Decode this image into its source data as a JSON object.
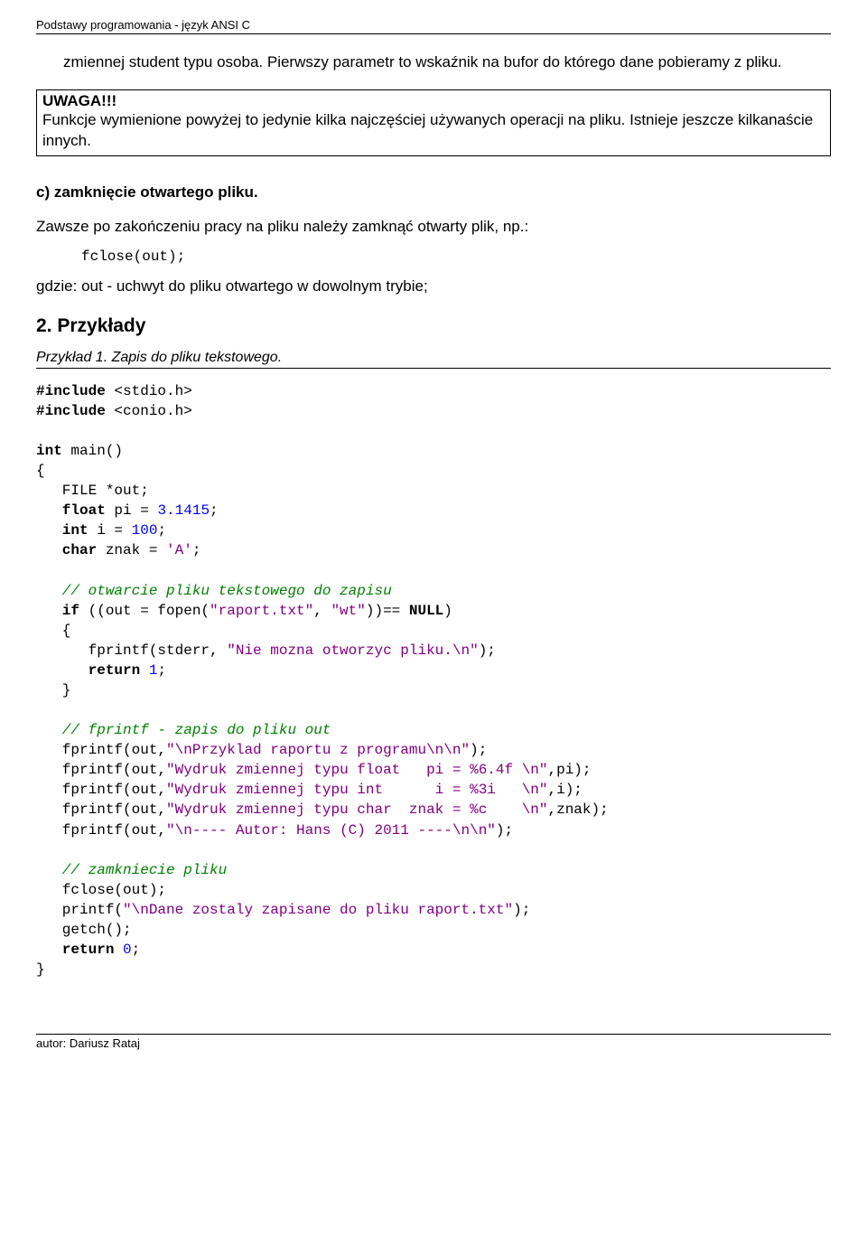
{
  "header": "Podstawy programowania - język ANSI C",
  "para_intro": "zmiennej student typu osoba. Pierwszy parametr to wskaźnik na bufor do którego dane pobieramy z pliku.",
  "uwaga": {
    "title": "UWAGA!!!",
    "text": "Funkcje wymienione powyżej to jedynie kilka najczęściej używanych operacji na pliku. Istnieje jeszcze kilkanaście innych."
  },
  "section_c": "c) zamknięcie otwartego pliku.",
  "section_c_text": "Zawsze po zakończeniu pracy na pliku należy zamknąć otwarty plik, np.:",
  "code_fclose": "fclose(out);",
  "section_c_after": "gdzie: out - uchwyt do pliku otwartego w dowolnym trybie;",
  "h2": "2. Przykłady",
  "example1_title": "Przykład 1. Zapis do pliku tekstowego.",
  "code": {
    "inc": "#include",
    "stdio": " <stdio.h>",
    "conio": " <conio.h>",
    "int_sp": "int ",
    "mainp": "main()",
    "lb": "{",
    "file_out": "   FILE *out;",
    "float_sp": "   float ",
    "pi_eq": "pi = ",
    "pi_val": "3.1415",
    "semic": ";",
    "int_sp2": "   int ",
    "i_eq": "i = ",
    "i_val": "100",
    "char_sp": "   char ",
    "znak_eq": "znak = ",
    "znak_val": "'A'",
    "empty": "",
    "comm1": "   // otwarcie pliku tekstowego do zapisu",
    "if_sp": "   if ",
    "if_rest1": "((out = fopen(",
    "str_raport": "\"raport.txt\"",
    "comma_sp": ", ",
    "str_wt": "\"wt\"",
    "if_rest2": "))== ",
    "null": "NULL",
    "rp": ")",
    "lb2": "   {",
    "fprintf_stderr_a": "      fprintf(stderr, ",
    "str_nie": "\"Nie mozna otworzyc pliku.\\n\"",
    "rps": ");",
    "return_sp": "      return ",
    "one": "1",
    "rb2": "   }",
    "comm2": "   // fprintf - zapis do pliku out",
    "fp_a": "   fprintf(out,",
    "s1": "\"\\nPrzyklad raportu z programu\\n\\n\"",
    "s2": "\"Wydruk zmiennej typu float   pi = %6.4f \\n\"",
    "tail_pi": ",pi);",
    "s3": "\"Wydruk zmiennej typu int      i = %3i   \\n\"",
    "tail_i": ",i);",
    "s4": "\"Wydruk zmiennej typu char  znak = %c    \\n\"",
    "tail_znak": ",znak);",
    "s5": "\"\\n---- Autor: Hans (C) 2011 ----\\n\\n\"",
    "comm3": "   // zamkniecie pliku",
    "fclose_out": "   fclose(out);",
    "printf_a": "   printf(",
    "str_dane": "\"\\nDane zostaly zapisane do pliku raport.txt\"",
    "getch": "   getch();",
    "return0_sp": "   return ",
    "zero": "0",
    "rb": "}"
  },
  "footer": "autor: Dariusz Rataj"
}
